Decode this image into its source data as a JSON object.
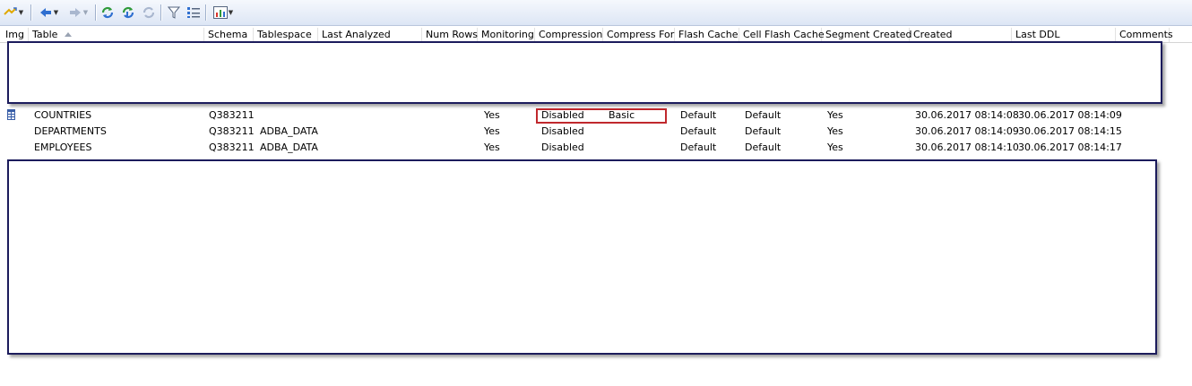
{
  "toolbar": {
    "buttons": [
      {
        "name": "run-icon",
        "has_dropdown": true
      },
      {
        "name": "back-arrow-icon",
        "has_dropdown": true
      },
      {
        "name": "forward-arrow-icon",
        "has_dropdown": true
      },
      {
        "name": "refresh-icon",
        "has_dropdown": false
      },
      {
        "name": "refresh-one-icon",
        "has_dropdown": false
      },
      {
        "name": "refresh-disabled-icon",
        "has_dropdown": false
      },
      {
        "name": "filter-icon",
        "has_dropdown": false
      },
      {
        "name": "list-icon",
        "has_dropdown": false
      },
      {
        "name": "chart-icon",
        "has_dropdown": true
      }
    ]
  },
  "table": {
    "columns": [
      "Img",
      "Table",
      "Schema",
      "Tablespace",
      "Last Analyzed",
      "Num Rows",
      "Monitoring",
      "Compression",
      "Compress For",
      "Flash Cache",
      "Cell Flash Cache",
      "Segment Created",
      "Created",
      "Last DDL",
      "Comments"
    ],
    "sorted_column": "Table",
    "rows": [
      {
        "table": "COUNTRIES",
        "schema": "Q383211",
        "tablespace": "",
        "monitoring": "Yes",
        "compression": "Disabled",
        "compress_for": "Basic",
        "flash_cache": "Default",
        "cell_flash_cache": "Default",
        "segment_created": "Yes",
        "created": "30.06.2017 08:14:08",
        "last_ddl": "30.06.2017 08:14:09",
        "icon": "table-icon"
      },
      {
        "table": "DEPARTMENTS",
        "schema": "Q383211",
        "tablespace": "ADBA_DATA",
        "monitoring": "Yes",
        "compression": "Disabled",
        "compress_for": "",
        "flash_cache": "Default",
        "cell_flash_cache": "Default",
        "segment_created": "Yes",
        "created": "30.06.2017 08:14:09",
        "last_ddl": "30.06.2017 08:14:15"
      },
      {
        "table": "EMPLOYEES",
        "schema": "Q383211",
        "tablespace": "ADBA_DATA",
        "monitoring": "Yes",
        "compression": "Disabled",
        "compress_for": "",
        "flash_cache": "Default",
        "cell_flash_cache": "Default",
        "segment_created": "Yes",
        "created": "30.06.2017 08:14:10",
        "last_ddl": "30.06.2017 08:14:17"
      }
    ]
  },
  "colors": {
    "highlight_border": "#c0282d",
    "redaction_border": "#1c1c5c",
    "toolbar_bg": "#dde6f5"
  }
}
